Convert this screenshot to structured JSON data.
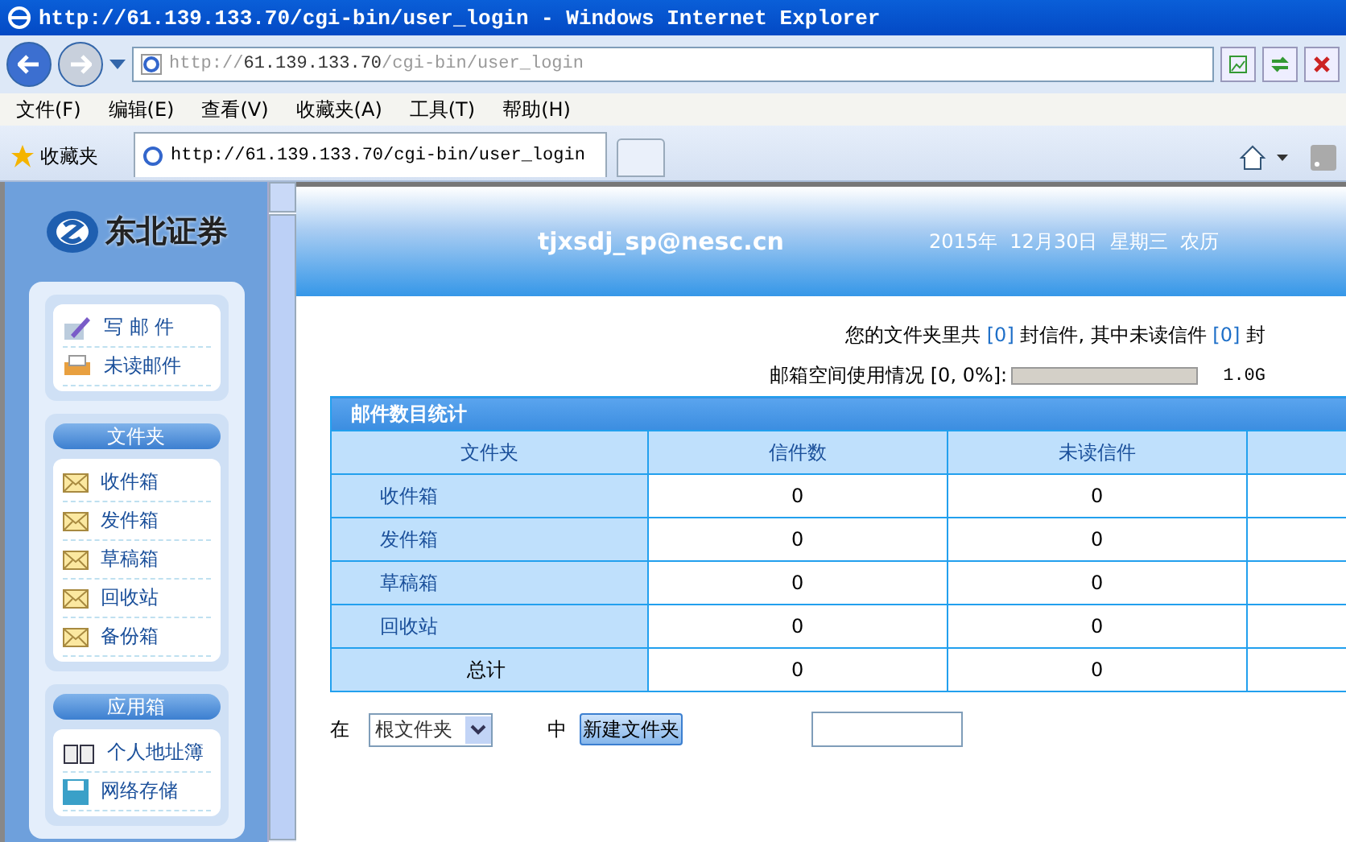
{
  "window": {
    "title": "http://61.139.133.70/cgi-bin/user_login - Windows Internet Explorer"
  },
  "address_bar": {
    "url_host": "http://61.139.133.70",
    "url_path": "/cgi-bin/user_login"
  },
  "menu_bar": [
    "文件(F)",
    "编辑(E)",
    "查看(V)",
    "收藏夹(A)",
    "工具(T)",
    "帮助(H)"
  ],
  "favorites": {
    "label": "收藏夹"
  },
  "tabs": [
    {
      "label": "http://61.139.133.70/cgi-bin/user_login",
      "selected": true
    }
  ],
  "sidebar": {
    "logo": "东北证券",
    "sections": [
      {
        "items": [
          {
            "label": "写 邮 件",
            "kind": "compose"
          },
          {
            "label": "未读邮件",
            "kind": "unread"
          }
        ]
      },
      {
        "title": "文件夹",
        "items": [
          {
            "label": "收件箱",
            "kind": "envelope"
          },
          {
            "label": "发件箱",
            "kind": "envelope"
          },
          {
            "label": "草稿箱",
            "kind": "envelope"
          },
          {
            "label": "回收站",
            "kind": "envelope"
          },
          {
            "label": "备份箱",
            "kind": "envelope"
          }
        ]
      },
      {
        "title": "应用箱",
        "items": [
          {
            "label": "个人地址簿",
            "kind": "book"
          },
          {
            "label": "网络存储",
            "kind": "disk"
          }
        ]
      }
    ]
  },
  "banner": {
    "email": "tjxsdj_sp@nesc.cn",
    "date": "2015年  12月30日  星期三  农历"
  },
  "summary": {
    "parts": [
      "您的文件夹里共",
      "[0]",
      "封信件, 其中未读信件",
      "[0]",
      "封"
    ],
    "usage_label": "邮箱空间使用情况 [0, 0%]:",
    "usage": {
      "level": 0
    },
    "capacity": "1.0G"
  },
  "table": {
    "title": "邮件数目统计",
    "columns": [
      "文件夹",
      "信件数",
      "未读信件"
    ],
    "rows": [
      {
        "kind": "folder",
        "cells": [
          "收件箱",
          "0",
          "0"
        ]
      },
      {
        "kind": "folder",
        "cells": [
          "发件箱",
          "0",
          "0"
        ]
      },
      {
        "kind": "folder",
        "cells": [
          "草稿箱",
          "0",
          "0"
        ]
      },
      {
        "kind": "folder",
        "cells": [
          "回收站",
          "0",
          "0"
        ]
      },
      {
        "kind": "total",
        "cells": [
          "总计",
          "0",
          "0"
        ]
      }
    ]
  },
  "new_folder": {
    "prefix": "在",
    "select_value": "根文件夹",
    "middle": "中",
    "button": "新建文件夹"
  }
}
